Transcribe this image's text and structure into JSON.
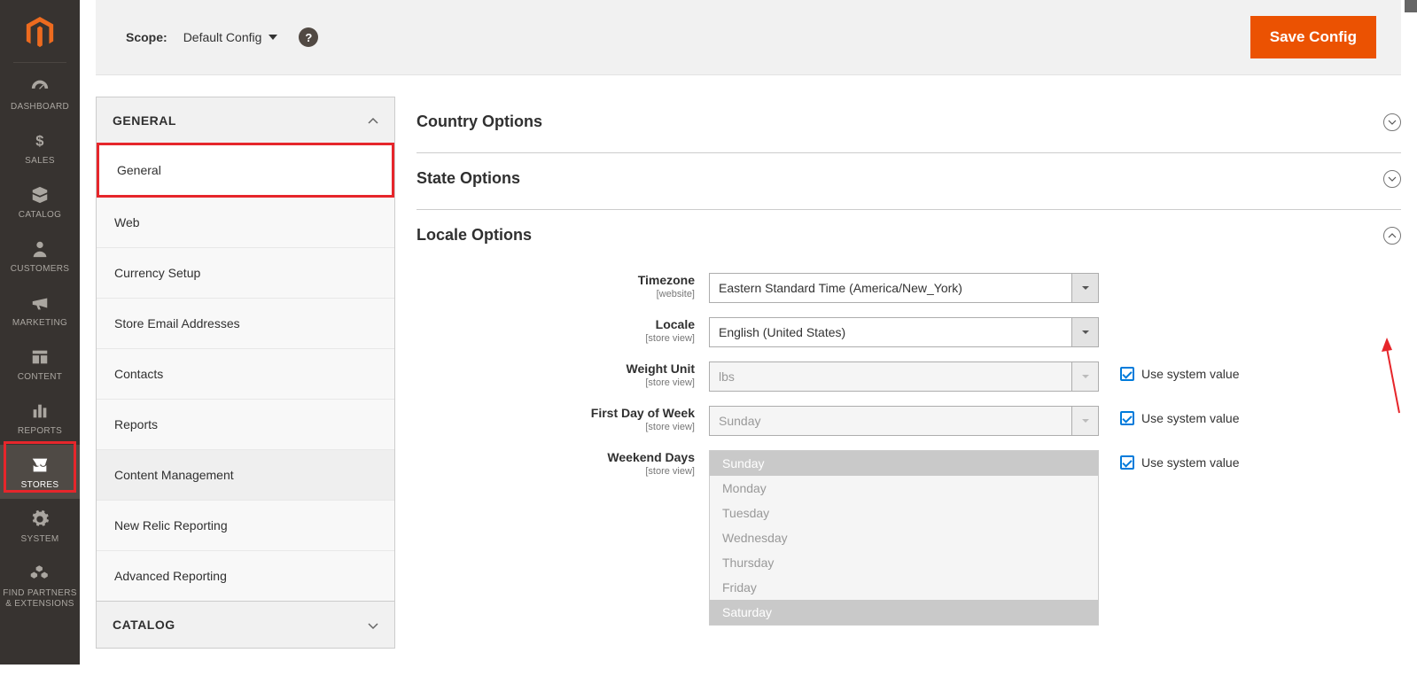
{
  "sidebar": {
    "items": [
      {
        "label": "DASHBOARD",
        "icon": "dashboard"
      },
      {
        "label": "SALES",
        "icon": "dollar"
      },
      {
        "label": "CATALOG",
        "icon": "box"
      },
      {
        "label": "CUSTOMERS",
        "icon": "person"
      },
      {
        "label": "MARKETING",
        "icon": "megaphone"
      },
      {
        "label": "CONTENT",
        "icon": "layout"
      },
      {
        "label": "REPORTS",
        "icon": "bars"
      },
      {
        "label": "STORES",
        "icon": "storefront"
      },
      {
        "label": "SYSTEM",
        "icon": "gear"
      },
      {
        "label": "FIND PARTNERS & EXTENSIONS",
        "icon": "cubes"
      }
    ]
  },
  "topbar": {
    "scope_label": "Scope:",
    "scope_value": "Default Config",
    "save_label": "Save Config"
  },
  "config_nav": {
    "sections": [
      {
        "title": "GENERAL",
        "expanded": true,
        "items": [
          {
            "label": "General",
            "selected": true
          },
          {
            "label": "Web"
          },
          {
            "label": "Currency Setup"
          },
          {
            "label": "Store Email Addresses"
          },
          {
            "label": "Contacts"
          },
          {
            "label": "Reports"
          },
          {
            "label": "Content Management",
            "alt": true
          },
          {
            "label": "New Relic Reporting"
          },
          {
            "label": "Advanced Reporting"
          }
        ]
      },
      {
        "title": "CATALOG",
        "expanded": false
      }
    ]
  },
  "panel": {
    "groups_collapsed": [
      {
        "title": "Country Options"
      },
      {
        "title": "State Options"
      }
    ],
    "group_locale_title": "Locale Options",
    "rows": {
      "timezone": {
        "label": "Timezone",
        "scope": "[website]",
        "value": "Eastern Standard Time (America/New_York)"
      },
      "locale": {
        "label": "Locale",
        "scope": "[store view]",
        "value": "English (United States)"
      },
      "weight": {
        "label": "Weight Unit",
        "scope": "[store view]",
        "value": "lbs"
      },
      "firstday": {
        "label": "First Day of Week",
        "scope": "[store view]",
        "value": "Sunday"
      },
      "weekend": {
        "label": "Weekend Days",
        "scope": "[store view]",
        "options": [
          "Sunday",
          "Monday",
          "Tuesday",
          "Wednesday",
          "Thursday",
          "Friday",
          "Saturday"
        ],
        "selected": [
          "Sunday",
          "Saturday"
        ]
      }
    },
    "use_system_value_label": "Use system value"
  }
}
